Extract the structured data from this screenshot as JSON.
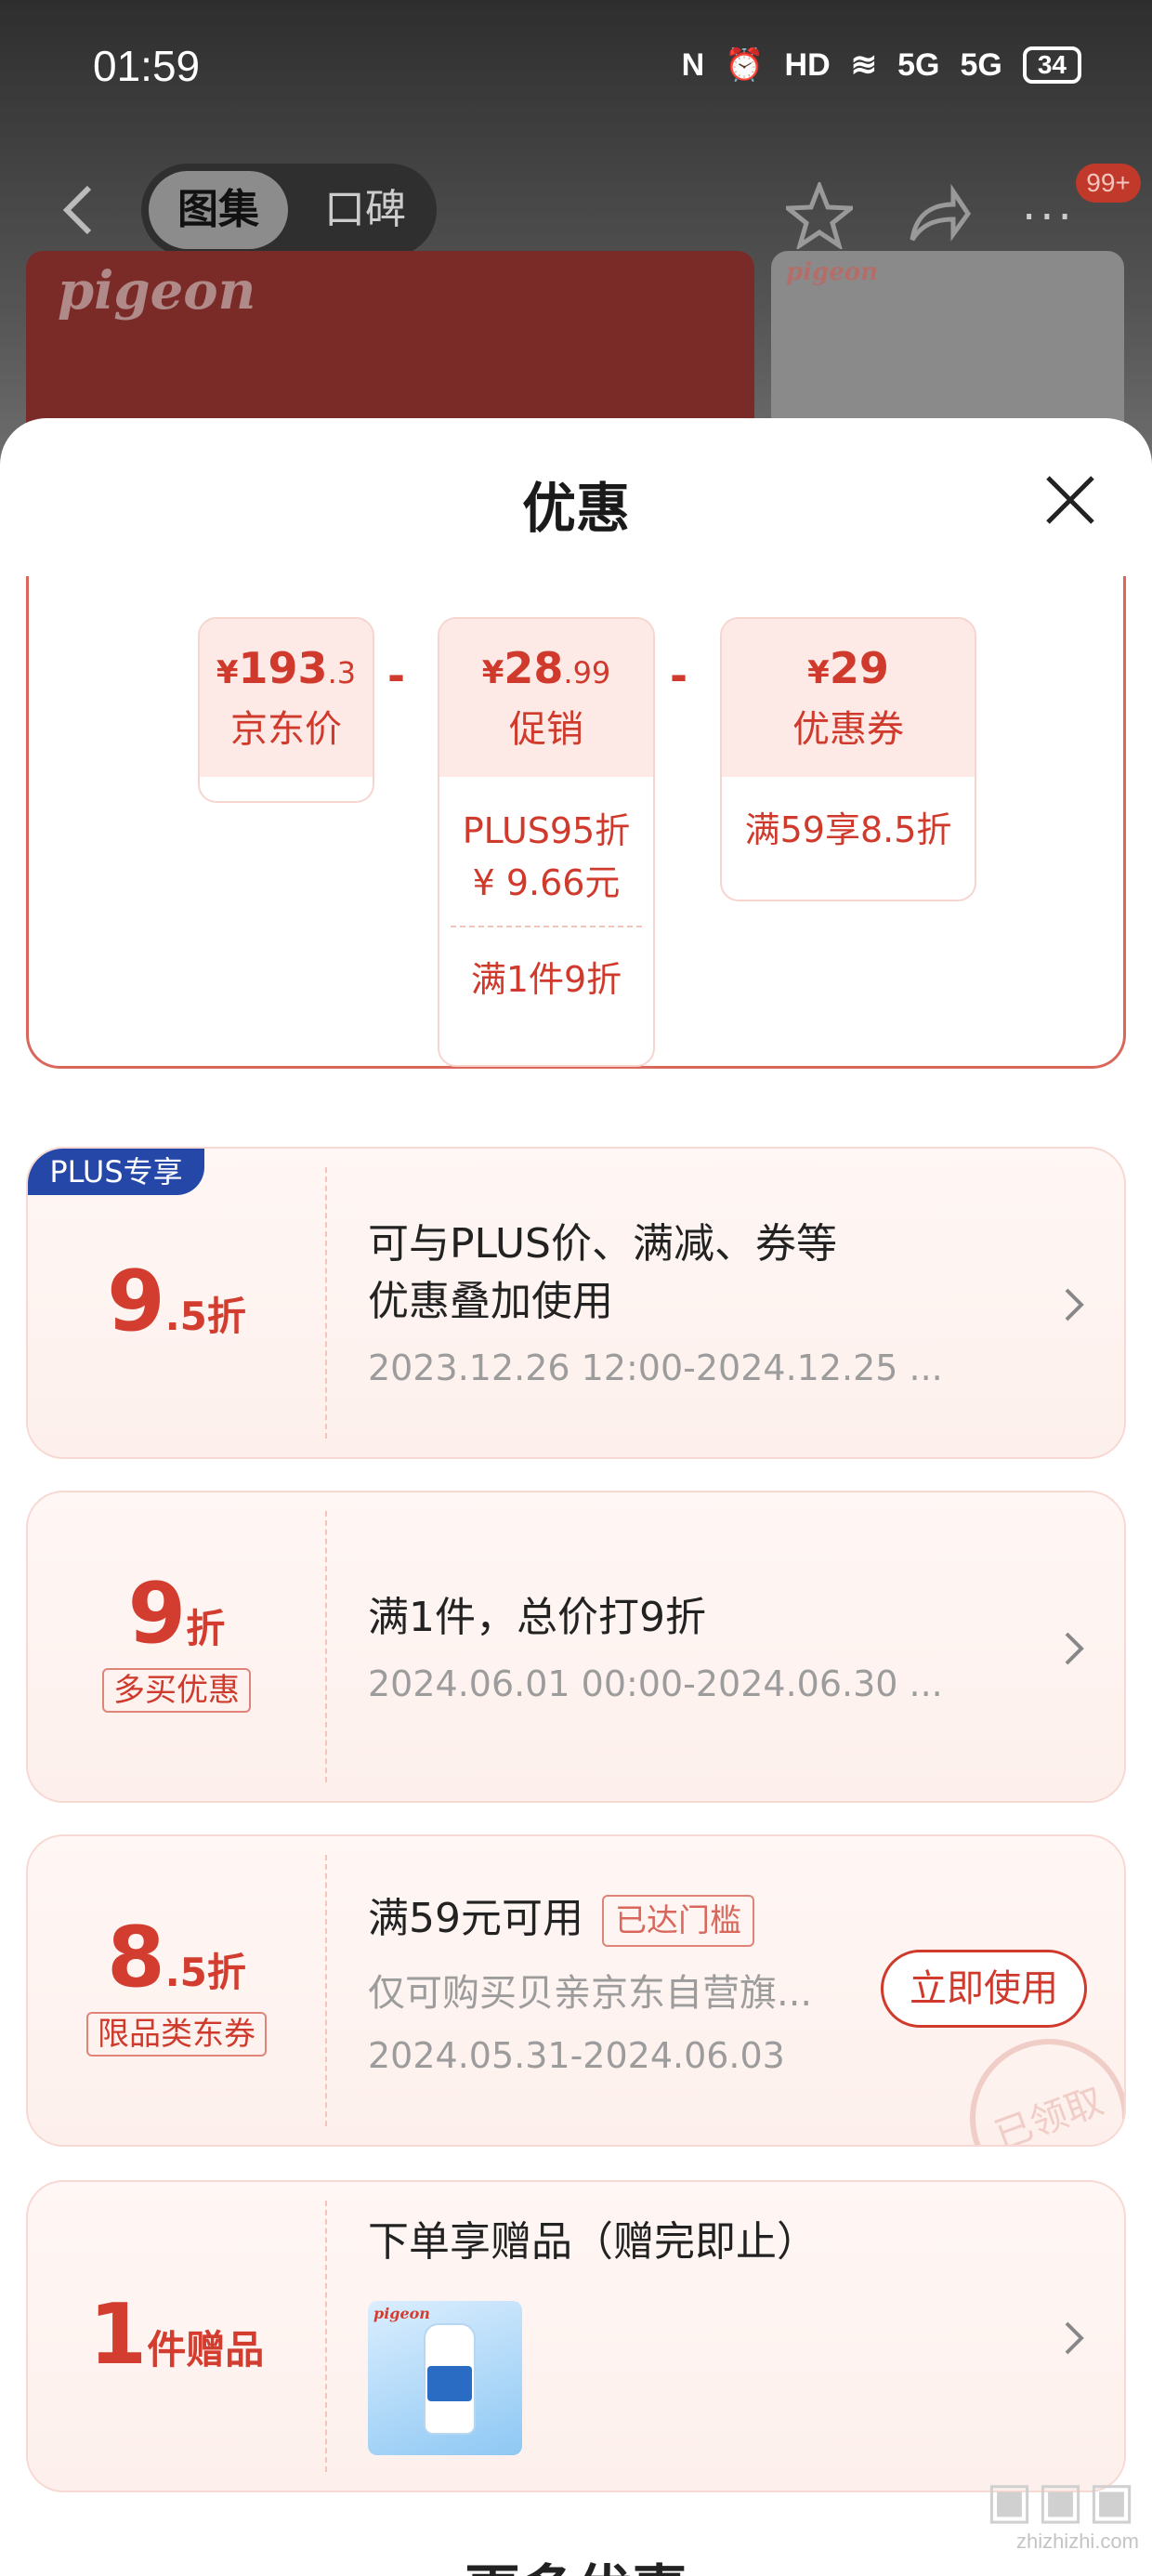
{
  "status_bar": {
    "time": "01:59",
    "signal1": "5G",
    "signal2": "5G",
    "hd_label": "HD",
    "battery": "34"
  },
  "nav": {
    "tab_active": "图集",
    "tab_inactive": "口碑",
    "more": "···",
    "badge": "99+"
  },
  "banner": {
    "brand": "pigeon"
  },
  "sheet": {
    "title": "优惠"
  },
  "summary": {
    "jd_price": {
      "yen": "¥",
      "int": "193",
      "dec": ".3",
      "label": "京东价"
    },
    "op1": "-",
    "promo": {
      "yen": "¥",
      "int": "28",
      "dec": ".99",
      "label": "促销",
      "sub1_line1": "PLUS95折",
      "sub1_line2": "¥ 9.66元",
      "sub2": "满1件9折"
    },
    "op2": "-",
    "coupon": {
      "yen": "¥",
      "int": "29",
      "label": "优惠券",
      "sub": "满59享8.5折"
    }
  },
  "cards": [
    {
      "tag": "PLUS专享",
      "num": "9",
      "suffix": ".5折",
      "line1": "可与PLUS价、满减、券等",
      "line2": "优惠叠加使用",
      "date": "2023.12.26 12:00-2024.12.25 ..."
    },
    {
      "num": "9",
      "suffix": "折",
      "badge": "多买优惠",
      "line1": "满1件，总价打9折",
      "date": "2024.06.01 00:00-2024.06.30 ..."
    },
    {
      "num": "8",
      "suffix": ".5折",
      "badge": "限品类东券",
      "line1": "满59元可用",
      "reached": "已达门槛",
      "line2": "仅可购买贝亲京东自营旗...",
      "date": "2024.05.31-2024.06.03",
      "button": "立即使用",
      "stamp": "已领取"
    },
    {
      "num": "1",
      "suffix": "件赠品",
      "line1": "下单享赠品（赠完即止）",
      "gift_brand": "pigeon"
    }
  ],
  "more_title": "更多优惠",
  "watermark": {
    "text": "zhizhizhi.com"
  },
  "colors": {
    "accent": "#d33d2f",
    "plus_blue": "#2548a8",
    "card_bg": "#fdf0ec"
  }
}
